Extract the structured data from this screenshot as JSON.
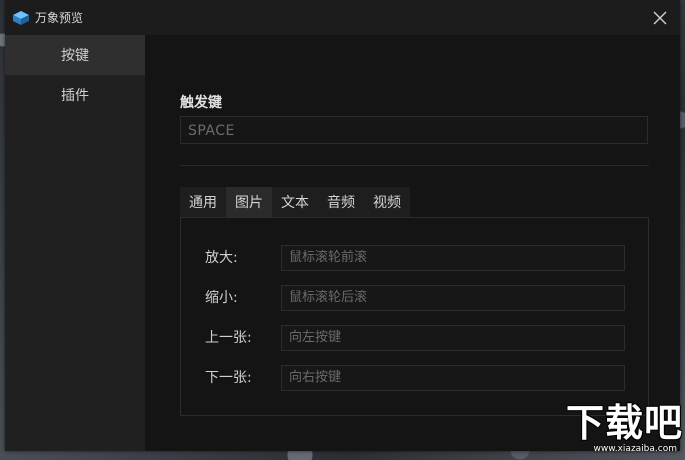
{
  "window": {
    "title": "万象预览",
    "close_icon": "close-icon",
    "app_icon": "app-cube-icon"
  },
  "sidebar": {
    "items": [
      {
        "label": "按键",
        "active": true
      },
      {
        "label": "插件",
        "active": false
      }
    ]
  },
  "trigger": {
    "label": "触发键",
    "value": "SPACE"
  },
  "tabs": [
    {
      "label": "通用",
      "active": false
    },
    {
      "label": "图片",
      "active": true
    },
    {
      "label": "文本",
      "active": false
    },
    {
      "label": "音频",
      "active": false
    },
    {
      "label": "视频",
      "active": false
    }
  ],
  "image_settings": {
    "rows": [
      {
        "label": "放大:",
        "value": "鼠标滚轮前滚"
      },
      {
        "label": "缩小:",
        "value": "鼠标滚轮后滚"
      },
      {
        "label": "上一张:",
        "value": "向左按键"
      },
      {
        "label": "下一张:",
        "value": "向右按键"
      }
    ]
  },
  "watermark": {
    "main": "下载吧",
    "sub": "www.xiazaiba.com"
  },
  "colors": {
    "window_bg": "#1c1c1c",
    "sidebar_bg": "#202020",
    "sidebar_active": "#2f2f2f",
    "content_bg": "#141414",
    "tab_active": "#2b2b2b",
    "border": "#2c2c2c",
    "icon_blue": "#3fa3e8"
  }
}
